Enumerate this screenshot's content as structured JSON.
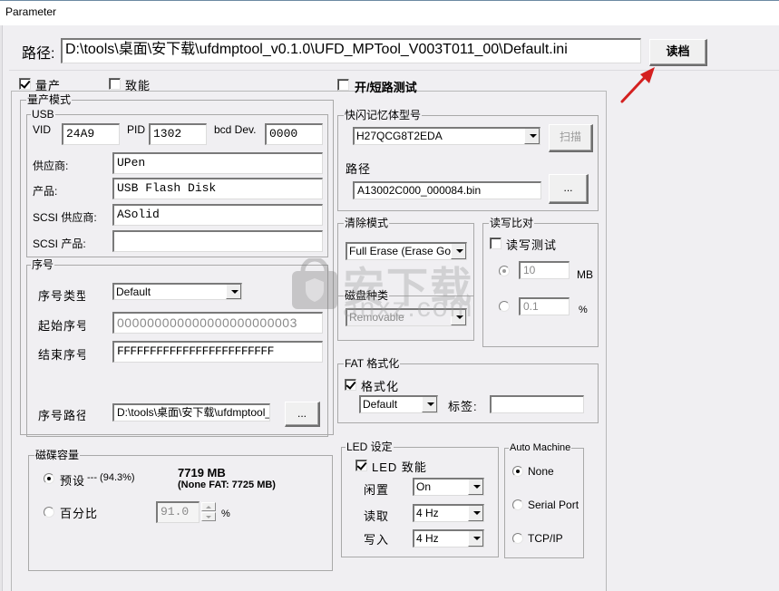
{
  "window": {
    "title": "Parameter"
  },
  "path_row": {
    "label": "路径:",
    "value": "D:\\tools\\桌面\\安下载\\ufdmptool_v0.1.0\\UFD_MPTool_V003T011_00\\Default.ini",
    "load_button": "读档"
  },
  "top_checks": {
    "mass_production": {
      "label": "量产",
      "checked": true
    },
    "enable": {
      "label": "致能",
      "checked": false
    },
    "open_short_test": {
      "label": "开/短路测试",
      "checked": false
    }
  },
  "mass_mode": {
    "title": "量产模式",
    "usb": {
      "title": "USB",
      "vid_label": "VID",
      "vid": "24A9",
      "pid_label": "PID",
      "pid": "1302",
      "bcd_label": "bcd Dev.",
      "bcd": "0000",
      "vendor_label": "供应商:",
      "vendor": "UPen",
      "product_label": "产品:",
      "product": "USB Flash Disk",
      "scsi_vendor_label": "SCSI 供应商:",
      "scsi_vendor": "ASolid",
      "scsi_product_label": "SCSI 产品:",
      "scsi_product": ""
    },
    "serial": {
      "title": "序号",
      "type_label": "序号类型",
      "type": "Default",
      "start_label": "起始序号",
      "start": "000000000000000000000003",
      "end_label": "结束序号",
      "end": "FFFFFFFFFFFFFFFFFFFFFFFF",
      "path_label": "序号路径",
      "path": "D:\\tools\\桌面\\安下载\\ufdmptool_v",
      "browse_button": "..."
    },
    "capacity": {
      "title": "磁碟容量",
      "preset_label": "预设",
      "preset_suffix": "--- (94.3%)",
      "preset_selected": true,
      "size": "7719  MB",
      "none_fat": "(None FAT: 7725 MB)",
      "percent_label": "百分比",
      "percent_selected": false,
      "percent_value": "91.0",
      "percent_unit": "%"
    }
  },
  "flash": {
    "title": "快闪记忆体型号",
    "model": "H27QCG8T2EDA",
    "scan_button": "扫描",
    "path_label": "路径",
    "path": "A13002C000_000084.bin",
    "browse_button": "..."
  },
  "erase": {
    "title": "清除模式",
    "mode": "Full Erase (Erase Good)",
    "disk_type_label": "磁盘种类",
    "disk_type": "Removable"
  },
  "rw_compare": {
    "title": "读写比对",
    "test_label": "读写测试",
    "test_checked": false,
    "mb_selected": true,
    "mb_value": "10",
    "mb_unit": "MB",
    "pct_selected": false,
    "pct_value": "0.1",
    "pct_unit": "%"
  },
  "fat": {
    "title": "FAT 格式化",
    "format_label": "格式化",
    "format_checked": true,
    "type": "Default",
    "tag_label": "标签:",
    "tag": ""
  },
  "led": {
    "title": "LED 设定",
    "enable_label": "LED 致能",
    "enable_checked": true,
    "idle_label": "闲置",
    "idle": "On",
    "read_label": "读取",
    "read": "4 Hz",
    "write_label": "写入",
    "write": "4 Hz"
  },
  "auto_machine": {
    "title": "Auto Machine",
    "options": [
      {
        "label": "None",
        "selected": true
      },
      {
        "label": "Serial Port",
        "selected": false
      },
      {
        "label": "TCP/IP",
        "selected": false
      }
    ]
  },
  "annotation": {
    "arrow_color": "#d42020"
  },
  "watermark": {
    "text": "安下载",
    "sub": "anxz.com"
  }
}
